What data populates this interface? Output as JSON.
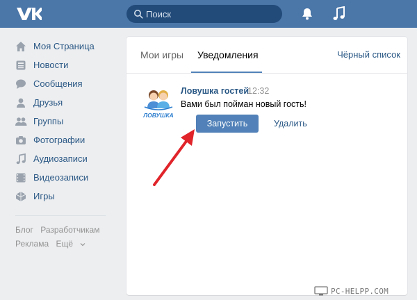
{
  "header": {
    "logo_icon": "vk-logo-icon",
    "search": {
      "placeholder": "Поиск",
      "icon": "search-icon"
    },
    "icons": [
      "bell-icon",
      "music-note-icon"
    ]
  },
  "sidebar": {
    "items": [
      {
        "label": "Моя Страница",
        "icon": "home-icon"
      },
      {
        "label": "Новости",
        "icon": "news-icon"
      },
      {
        "label": "Сообщения",
        "icon": "messages-icon"
      },
      {
        "label": "Друзья",
        "icon": "friend-icon"
      },
      {
        "label": "Группы",
        "icon": "groups-icon"
      },
      {
        "label": "Фотографии",
        "icon": "camera-icon"
      },
      {
        "label": "Аудиозаписи",
        "icon": "audio-icon"
      },
      {
        "label": "Видеозаписи",
        "icon": "video-icon"
      },
      {
        "label": "Игры",
        "icon": "games-icon"
      }
    ],
    "footer": {
      "blog": "Блог",
      "developers": "Разработчикам",
      "ads": "Реклама",
      "more": "Ещё"
    }
  },
  "main": {
    "tabs": [
      {
        "label": "Мои игры",
        "active": false
      },
      {
        "label": "Уведомления",
        "active": true
      }
    ],
    "blacklist_label": "Чёрный список",
    "notification": {
      "app_icon_text": "ЛОВУШКА",
      "app_name": "Ловушка гостей",
      "time": "12:32",
      "message": "Вами был пойман новый гость!",
      "run_label": "Запустить",
      "delete_label": "Удалить"
    }
  },
  "watermark": {
    "text": "PC-HELPP.COM"
  },
  "colors": {
    "header_bg": "#4a76a8",
    "link": "#2a5885",
    "button": "#5181b8",
    "arrow": "#e0242a",
    "page_bg": "#edeef0"
  }
}
